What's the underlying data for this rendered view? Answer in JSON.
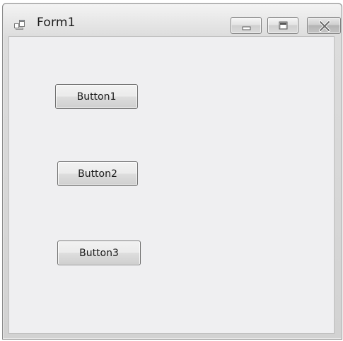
{
  "window": {
    "title": "Form1",
    "icon": "form-window-icon",
    "caption_buttons": [
      "minimize-icon",
      "maximize-icon",
      "close-icon"
    ]
  },
  "form": {
    "buttons": [
      {
        "label": "Button1"
      },
      {
        "label": "Button2"
      },
      {
        "label": "Button3"
      }
    ]
  },
  "colors": {
    "client_background": "#efeff1",
    "button_border": "#707070"
  }
}
